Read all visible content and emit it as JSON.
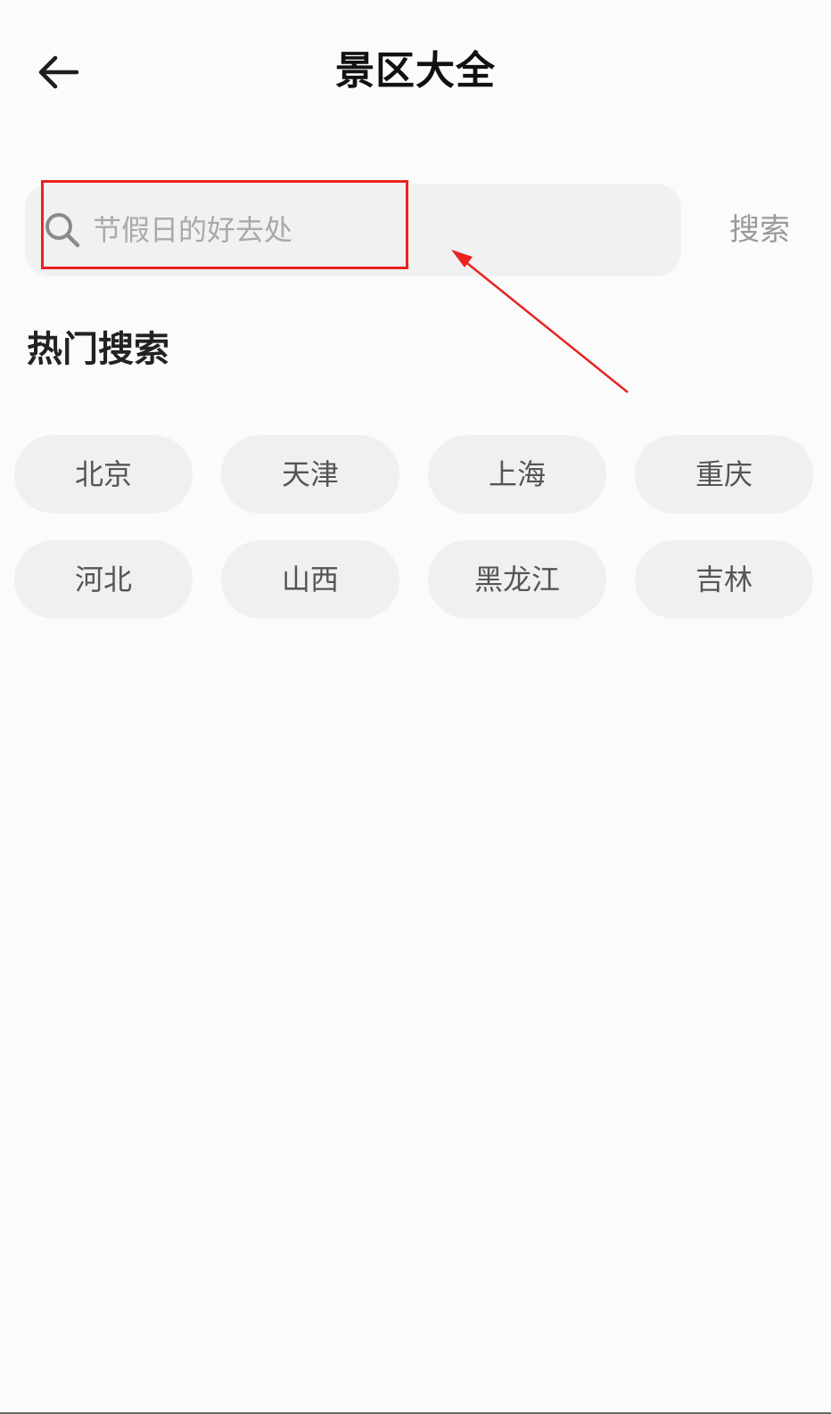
{
  "header": {
    "title": "景区大全",
    "back_icon": "arrow-left-icon"
  },
  "search": {
    "placeholder": "节假日的好去处",
    "value": "",
    "icon": "search-icon",
    "button_label": "搜索"
  },
  "hot_search": {
    "title": "热门搜索",
    "items": [
      {
        "label": "北京"
      },
      {
        "label": "天津"
      },
      {
        "label": "上海"
      },
      {
        "label": "重庆"
      },
      {
        "label": "河北"
      },
      {
        "label": "山西"
      },
      {
        "label": "黑龙江"
      },
      {
        "label": "吉林"
      }
    ]
  },
  "colors": {
    "background": "#fbfbfb",
    "chip_background": "#f0f0f0",
    "annotation": "#e8231f"
  }
}
